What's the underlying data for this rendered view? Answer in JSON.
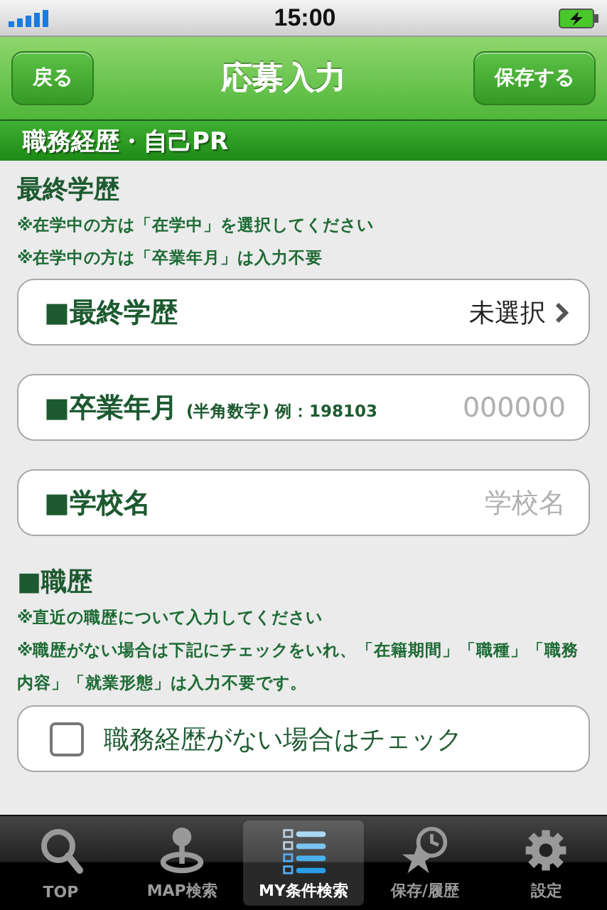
{
  "status_bar": {
    "time": "15:00"
  },
  "nav_bar": {
    "back": "戻る",
    "title": "応募入力",
    "save": "保存する"
  },
  "section_title": "職務経歴・自己PR",
  "education": {
    "heading": "最終学歴",
    "notes": [
      "※在学中の方は「在学中」を選択してください",
      "※在学中の方は「卒業年月」は入力不要"
    ],
    "fields": [
      {
        "kind": "select",
        "label": "■最終学歴",
        "value": "未選択"
      },
      {
        "kind": "input",
        "label": "■卒業年月",
        "hint": "(半角数字) 例：198103",
        "placeholder": "000000"
      },
      {
        "kind": "input",
        "label": "■学校名",
        "placeholder": "学校名"
      }
    ]
  },
  "career": {
    "heading": "■職歴",
    "notes": [
      "※直近の職歴について入力してください",
      "※職歴がない場合は下記にチェックをいれ、「在籍期間」「職種」「職務内容」「就業形態」は入力不要です。"
    ],
    "checkbox": {
      "label": "職務経歴がない場合はチェック",
      "checked": false
    }
  },
  "tab_bar": [
    {
      "kind": "search",
      "label": "TOP",
      "selected": false
    },
    {
      "kind": "map",
      "label": "MAP検索",
      "selected": false
    },
    {
      "kind": "list",
      "label": "MY条件検索",
      "selected": true
    },
    {
      "kind": "history",
      "label": "保存/履歴",
      "selected": false
    },
    {
      "kind": "settings",
      "label": "設定",
      "selected": false
    }
  ]
}
